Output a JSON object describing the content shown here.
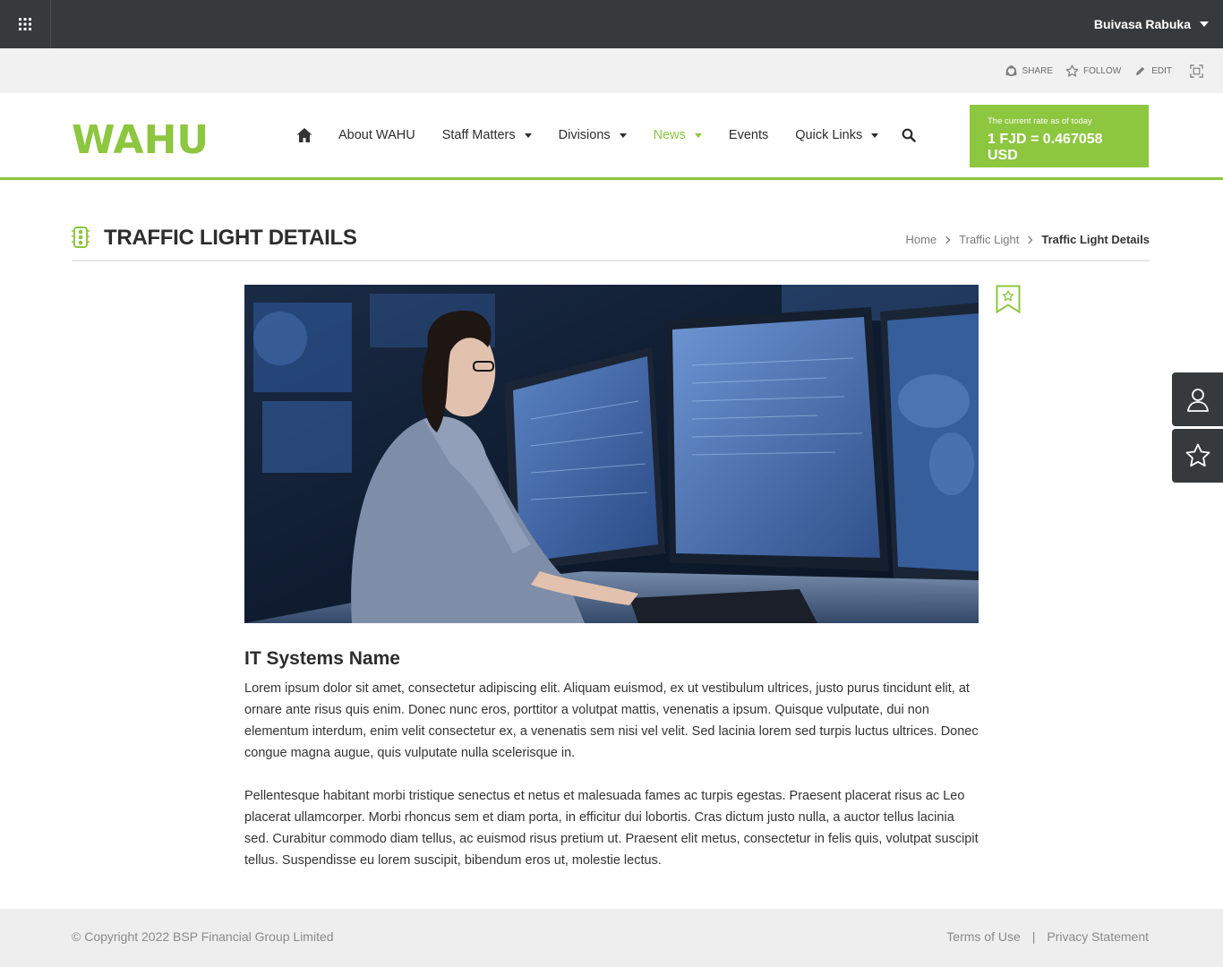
{
  "topbar": {
    "user_name": "Buivasa Rabuka"
  },
  "actions": {
    "share": "SHARE",
    "follow": "FOLLOW",
    "edit": "EDIT"
  },
  "brand": {
    "logo_text": "WAHU",
    "accent_color": "#8dc63f",
    "dark_color": "#373a3c"
  },
  "nav": {
    "items": [
      {
        "label": "About WAHU"
      },
      {
        "label": "Staff Matters"
      },
      {
        "label": "Divisions"
      },
      {
        "label": "News"
      },
      {
        "label": "Events"
      },
      {
        "label": "Quick Links"
      }
    ]
  },
  "rate": {
    "label": "The current rate as of today",
    "value": "1 FJD = 0.467058 USD"
  },
  "page": {
    "title": "TRAFFIC LIGHT DETAILS"
  },
  "breadcrumb": {
    "home": "Home",
    "parent": "Traffic Light",
    "current": "Traffic Light Details"
  },
  "article": {
    "heading": "IT Systems Name",
    "paragraph1": "Lorem ipsum dolor sit amet, consectetur adipiscing elit. Aliquam euismod, ex ut vestibulum ultrices, justo purus tincidunt elit, at ornare ante risus quis enim. Donec nunc eros, porttitor a volutpat mattis, venenatis a ipsum. Quisque vulputate, dui non elementum interdum, enim velit consectetur ex, a venenatis sem nisi vel velit. Sed lacinia lorem sed turpis luctus ultrices. Donec congue magna augue, quis vulputate nulla scelerisque in.",
    "paragraph2": "Pellentesque habitant morbi tristique senectus et netus et malesuada fames ac turpis egestas. Praesent placerat risus ac Leo placerat ullamcorper. Morbi rhoncus sem et diam porta, in efficitur dui lobortis. Cras dictum justo nulla, a auctor tellus lacinia sed. Curabitur commodo diam tellus, ac euismod risus pretium ut. Praesent elit metus, consectetur in felis quis, volutpat suscipit tellus. Suspendisse eu lorem suscipit, bibendum eros ut, molestie lectus."
  },
  "footer": {
    "copyright": "© Copyright 2022 BSP Financial Group Limited",
    "terms": "Terms of Use",
    "separator": "|",
    "privacy": "Privacy Statement"
  },
  "icons": {
    "app_launcher": "waffle-icon",
    "share": "share-icon",
    "follow": "star-icon",
    "edit": "pencil-icon",
    "focus": "focus-mode-icon",
    "home": "home-icon",
    "search": "search-icon",
    "title": "traffic-light-icon",
    "bookmark": "bookmark-star-icon",
    "profile": "user-icon",
    "favorites": "star-icon"
  }
}
